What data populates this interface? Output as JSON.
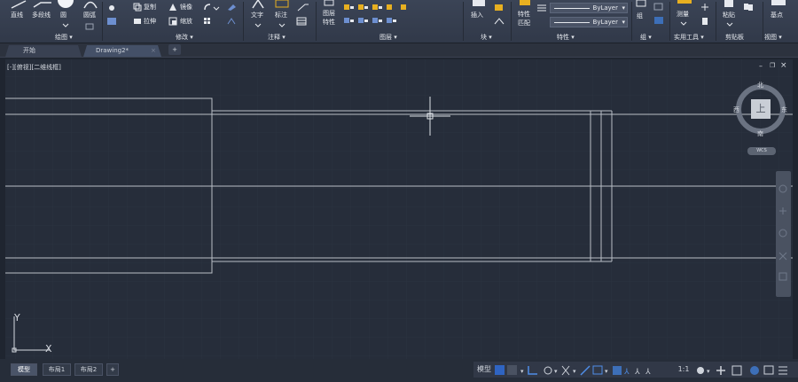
{
  "ribbon": {
    "draw": {
      "line": "直线",
      "polyline": "多段线",
      "circle": "圆",
      "arc": "圆弧",
      "title": "绘图 ▾"
    },
    "modify": {
      "copy": "复制",
      "mirror": "镜像",
      "stretch": "拉伸",
      "scale": "缩放",
      "title": "修改 ▾"
    },
    "annotation": {
      "text": "文字",
      "dimension": "标注",
      "title": "注释 ▾"
    },
    "layers": {
      "layer_props_l1": "图层",
      "layer_props_l2": "特性",
      "title": "图层 ▾"
    },
    "block": {
      "insert": "插入",
      "title": "块 ▾"
    },
    "properties": {
      "match_l1": "特性",
      "match_l2": "匹配",
      "linetype_value": "ByLayer",
      "lineweight_value": "ByLayer",
      "title": "特性 ▾"
    },
    "groups": {
      "group": "组",
      "title": "组 ▾"
    },
    "utilities": {
      "measure": "测量",
      "title": "实用工具 ▾"
    },
    "clipboard": {
      "paste": "粘贴",
      "title": "剪贴板"
    },
    "view": {
      "base": "基点",
      "title": "视图 ▾"
    },
    "accent_color": "#e8b020"
  },
  "file_tabs": {
    "start": "开始",
    "drawing": "Drawing2*",
    "close_glyph": "×",
    "add_glyph": "+"
  },
  "viewport": {
    "label": "[-][俯视][二维线框]",
    "min_glyph": "–",
    "restore_glyph": "❐",
    "close_glyph": "×",
    "viewcube": {
      "north": "北",
      "south": "南",
      "east": "东",
      "west": "西",
      "top": "上",
      "wcs": "WCS"
    },
    "ucs": {
      "x": "X",
      "y": "Y"
    }
  },
  "layout_tabs": {
    "model": "模型",
    "layout1": "布局1",
    "layout2": "布局2",
    "add_glyph": "+"
  },
  "statusbar": {
    "model": "模型",
    "scale": "1:1"
  }
}
